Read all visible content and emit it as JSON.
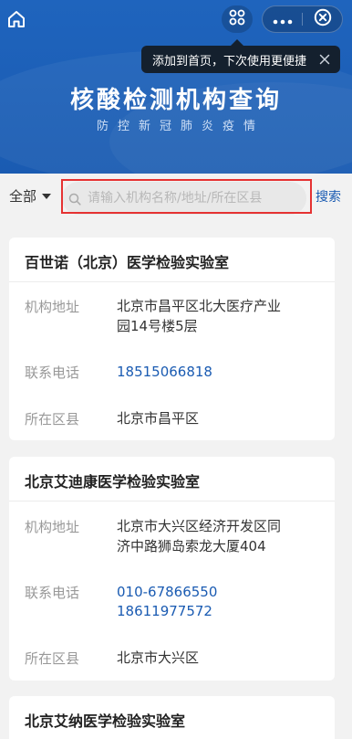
{
  "header": {
    "title": "核酸检测机构查询",
    "subtitle": "防控新冠肺炎疫情",
    "tooltip": "添加到首页，下次使用更便捷",
    "icons": [
      "home-icon",
      "scan-icon",
      "more-icon",
      "close-circle-icon",
      "close-icon"
    ]
  },
  "search": {
    "filter_label": "全部",
    "placeholder": "请输入机构名称/地址/所在区县",
    "value": "",
    "button_label": "搜索"
  },
  "labels": {
    "address": "机构地址",
    "phone": "联系电话",
    "district": "所在区县"
  },
  "results": [
    {
      "name": "百世诺（北京）医学检验实验室",
      "address_line1": "北京市昌平区北大医疗产业",
      "address_line2": "园14号楼5层",
      "phone1": "18515066818",
      "district": "北京市昌平区"
    },
    {
      "name": "北京艾迪康医学检验实验室",
      "address_line1": "北京市大兴区经济开发区同",
      "address_line2": "济中路狮岛索龙大厦404",
      "phone1": "010-67866550",
      "phone2": "18611977572",
      "district": "北京市大兴区"
    },
    {
      "name": "北京艾纳医学检验实验室"
    }
  ],
  "colors": {
    "brand_blue": "#1a5bb2",
    "highlight_red": "#e53232",
    "tooltip_bg": "#14202e"
  }
}
